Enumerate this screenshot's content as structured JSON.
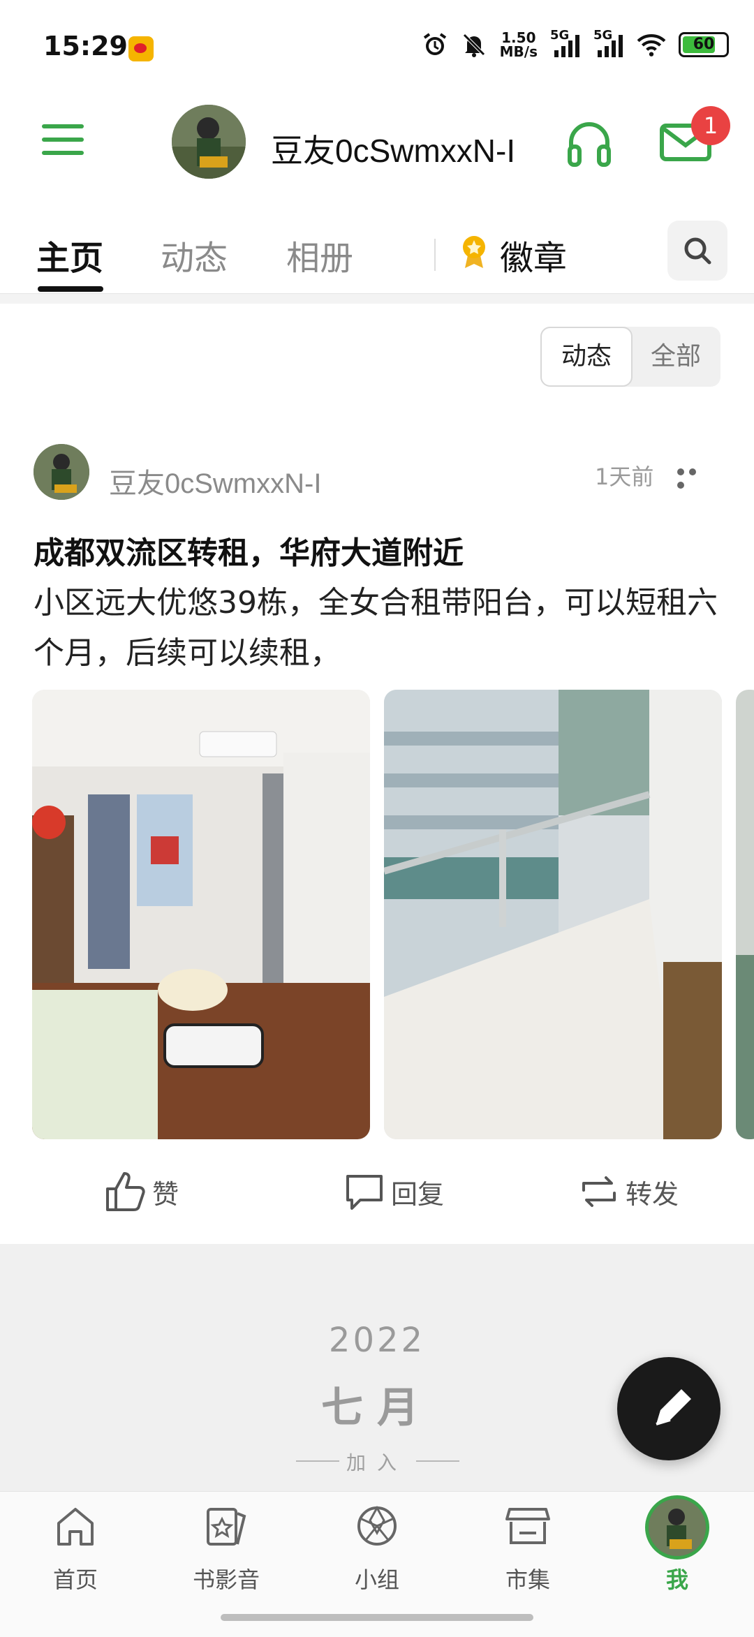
{
  "status_bar": {
    "time": "15:29",
    "net_speed_top": "1.50",
    "net_speed_bottom": "MB/s",
    "sim1": "5G",
    "sim2": "5G",
    "battery": "60"
  },
  "header": {
    "username": "豆友0cSwmxxN-I",
    "notification_count": "1"
  },
  "tabs": {
    "items": [
      {
        "label": "主页",
        "active": true
      },
      {
        "label": "动态",
        "active": false
      },
      {
        "label": "相册",
        "active": false
      }
    ],
    "badges_label": "徽章"
  },
  "filter": {
    "options": [
      "动态",
      "全部"
    ],
    "selected": "动态"
  },
  "post": {
    "username": "豆友0cSwmxxN-I",
    "time": "1天前",
    "title": "成都双流区转租，华府大道附近",
    "body": "小区远大优悠39栋，全女合租带阳台，可以短租六个月，后续可以续租，",
    "photos": [
      "bedroom-photo",
      "balcony-photo",
      "partial-photo"
    ],
    "actions": {
      "like": "赞",
      "reply": "回复",
      "repost": "转发"
    }
  },
  "join_info": {
    "year": "2022",
    "month": "七月",
    "label": "加入"
  },
  "bottom_nav": {
    "items": [
      {
        "label": "首页",
        "icon": "home-icon"
      },
      {
        "label": "书影音",
        "icon": "media-icon"
      },
      {
        "label": "小组",
        "icon": "group-icon"
      },
      {
        "label": "市集",
        "icon": "market-icon"
      },
      {
        "label": "我",
        "icon": "avatar",
        "active": true
      }
    ]
  },
  "colors": {
    "accent": "#3aa64a",
    "badge": "#e94242",
    "fab": "#1a1a1a"
  }
}
